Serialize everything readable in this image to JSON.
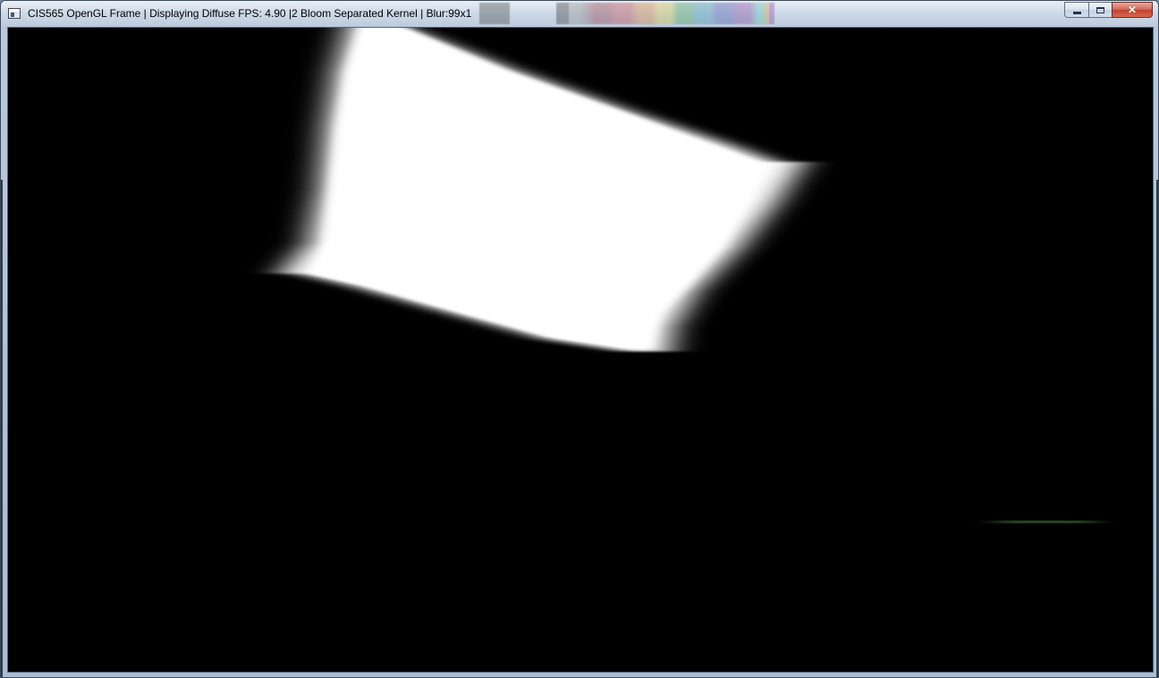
{
  "window": {
    "title": "CIS565 OpenGL Frame | Displaying Diffuse FPS: 4.90 |2 Bloom Separated Kernel | Blur:99x1",
    "icon": "opengl-app-icon",
    "caption_buttons": {
      "minimize_icon": "minimize-icon",
      "maximize_icon": "maximize-icon",
      "close_icon": "close-icon",
      "close_symbol": "✕"
    }
  },
  "viewport": {
    "background_color": "#000000",
    "bright_quad_color": "#ffffff",
    "streak_color": "#2c4a22"
  }
}
